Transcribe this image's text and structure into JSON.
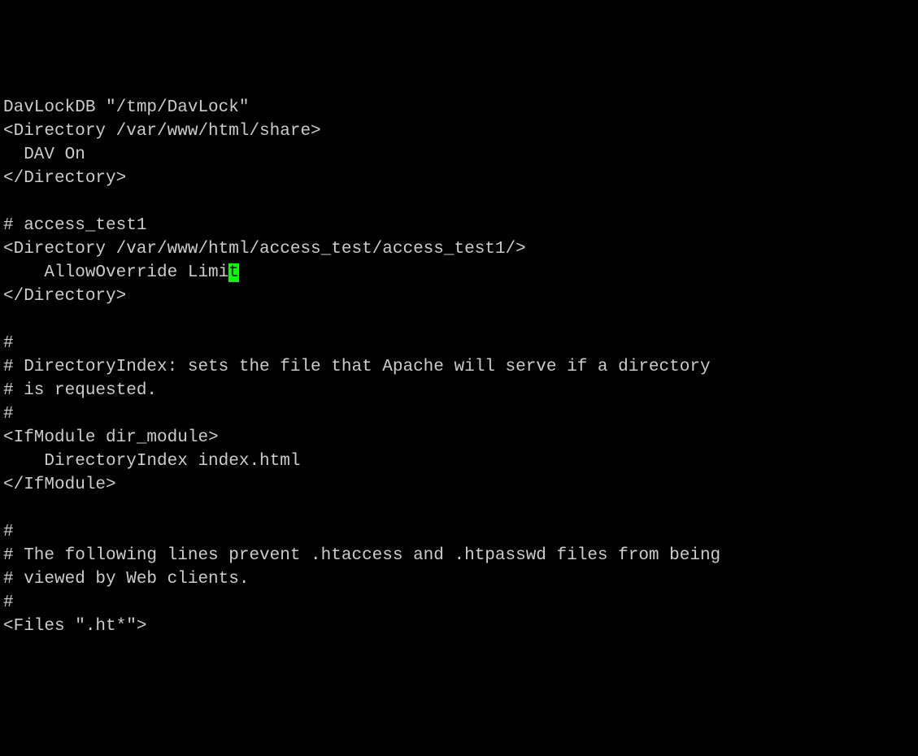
{
  "lines": [
    "DavLockDB \"/tmp/DavLock\"",
    "<Directory /var/www/html/share>",
    "  DAV On",
    "</Directory>",
    "",
    "# access_test1",
    "<Directory /var/www/html/access_test/access_test1/>",
    "    AllowOverride Limi",
    "</Directory>",
    "",
    "#",
    "# DirectoryIndex: sets the file that Apache will serve if a directory",
    "# is requested.",
    "#",
    "<IfModule dir_module>",
    "    DirectoryIndex index.html",
    "</IfModule>",
    "",
    "#",
    "# The following lines prevent .htaccess and .htpasswd files from being",
    "# viewed by Web clients.",
    "#",
    "<Files \".ht*\">"
  ],
  "cursor": {
    "line_index": 7,
    "char": "t"
  }
}
